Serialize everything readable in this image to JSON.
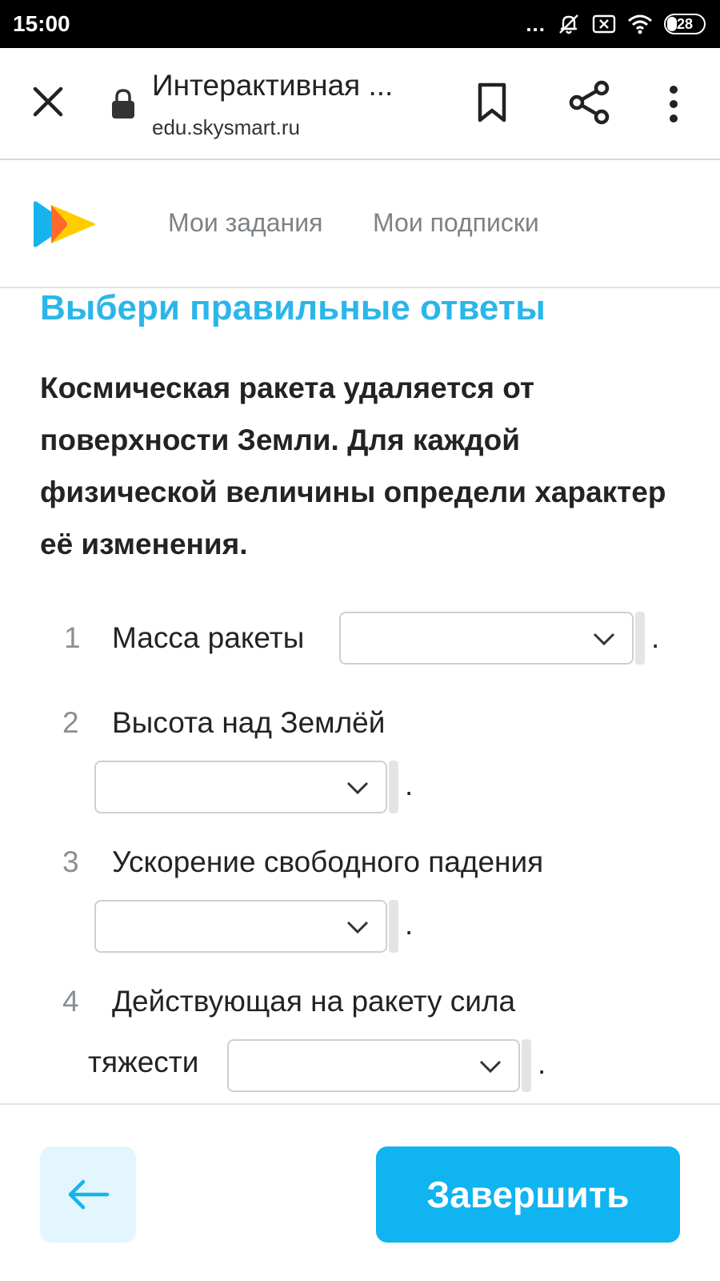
{
  "status_bar": {
    "time": "15:00",
    "dots": "...",
    "battery": "28"
  },
  "browser": {
    "title": "Интерактивная ...",
    "url": "edu.skysmart.ru"
  },
  "site_nav": {
    "items": [
      {
        "label": "Мои задания"
      },
      {
        "label": "Мои подписки"
      }
    ]
  },
  "task": {
    "heading": "Выбери правильные ответы",
    "question": "Космическая ракета удаляется от поверхности Земли. Для каждой физической величины определи характер её изменения.",
    "items": [
      {
        "num": "1",
        "label": "Масса ракеты",
        "selected": "",
        "end": "."
      },
      {
        "num": "2",
        "label": "Высота над Землёй",
        "selected": "",
        "end": "."
      },
      {
        "num": "3",
        "label": "Ускорение свободного падения",
        "selected": "",
        "end": "."
      },
      {
        "num": "4",
        "label": "Действующая на ракету сила",
        "label_cont": "тяжести",
        "selected": "",
        "end": "."
      }
    ]
  },
  "footer": {
    "back_icon": "arrow-left-icon",
    "finish_label": "Завершить"
  },
  "colors": {
    "accent": "#2bb6ea",
    "button": "#0fb4f0",
    "back_button_bg": "#e3f6fd"
  }
}
